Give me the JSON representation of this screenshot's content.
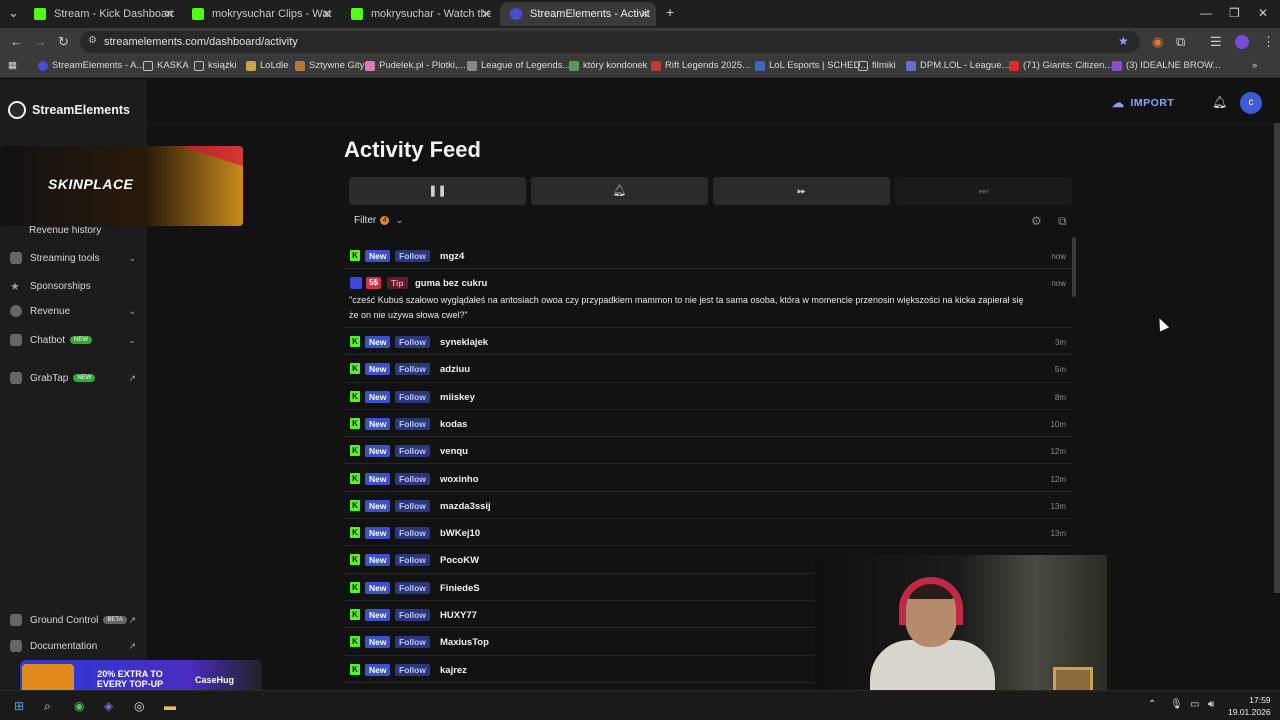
{
  "tabs": [
    {
      "title": "Stream - Kick Dashboard",
      "color": "#53fc18"
    },
    {
      "title": "mokrysuchar Clips - Watch Live",
      "color": "#53fc18"
    },
    {
      "title": "mokrysuchar - Watch the VOD",
      "color": "#53fc18"
    },
    {
      "title": "StreamElements - Activity feed",
      "color": "#4b4bd6"
    }
  ],
  "address": {
    "url": "streamelements.com/dashboard/activity"
  },
  "bookmarks": [
    "StreamElements - A...",
    "KASKA",
    "książki",
    "LoLdle",
    "Sztywne Gity",
    "Pudelek.pl - Plotki,...",
    "League of Legends...",
    "który kondonek",
    "Rift Legends 2025...",
    "LoL Esports | SCHED...",
    "filmiki",
    "DPM.LOL - League...",
    "(71) Giants: Citizen...",
    "(3) IDEALNE BROW..."
  ],
  "brand": {
    "name": "StreamElements"
  },
  "ad": {
    "text": "SKINPLACE"
  },
  "sidebar": {
    "items": [
      {
        "label": "Revenue history"
      },
      {
        "label": "Streaming tools"
      },
      {
        "label": "Sponsorships"
      },
      {
        "label": "Revenue"
      },
      {
        "label": "Chatbot",
        "badge": "NEW"
      },
      {
        "label": "GrabTap",
        "badge": "NEW"
      }
    ],
    "bottom": [
      {
        "label": "Ground Control",
        "badge": "BETA"
      },
      {
        "label": "Documentation"
      }
    ]
  },
  "header": {
    "import_label": "IMPORT",
    "avatar_letter": "c"
  },
  "feed": {
    "title": "Activity Feed",
    "filter_label": "Filter",
    "filter_count": "4",
    "new_label": "New",
    "follow_label": "Follow",
    "tip": {
      "amount": "5$",
      "label": "Tip",
      "name": "guma bez cukru",
      "time": "now",
      "message": "\"cześć Kubuś szałowo wyglądałeś na antosiach owoa czy przypadkiem mammon to nie jest ta sama osoba, która w momencie przenosin większości na kicka zapierał się że on nie używa słowa cwel?\""
    },
    "events": [
      {
        "name": "mgz4",
        "time": "now"
      },
      {
        "name": "synekIajek",
        "time": "3m"
      },
      {
        "name": "adziuu",
        "time": "5m"
      },
      {
        "name": "miiskey",
        "time": "8m"
      },
      {
        "name": "kodas",
        "time": "10m"
      },
      {
        "name": "venqu",
        "time": "12m"
      },
      {
        "name": "woxinho",
        "time": "12m"
      },
      {
        "name": "mazda3ssij",
        "time": "13m"
      },
      {
        "name": "bWKej10",
        "time": "13m"
      },
      {
        "name": "PocoKW",
        "time": ""
      },
      {
        "name": "FiniedeS",
        "time": ""
      },
      {
        "name": "HUXY77",
        "time": ""
      },
      {
        "name": "MaxiusTop",
        "time": ""
      },
      {
        "name": "kajrez",
        "time": ""
      }
    ]
  },
  "case_ad": {
    "promo": "20% EXTRA TO EVERY TOP-UP",
    "brand": "CaseHug"
  },
  "clock": {
    "time": "17:59",
    "date": "19.01.2026"
  },
  "colors": {
    "kick": "#53fc18",
    "accent": "#3c52c9",
    "tip": "#d02f4f"
  }
}
